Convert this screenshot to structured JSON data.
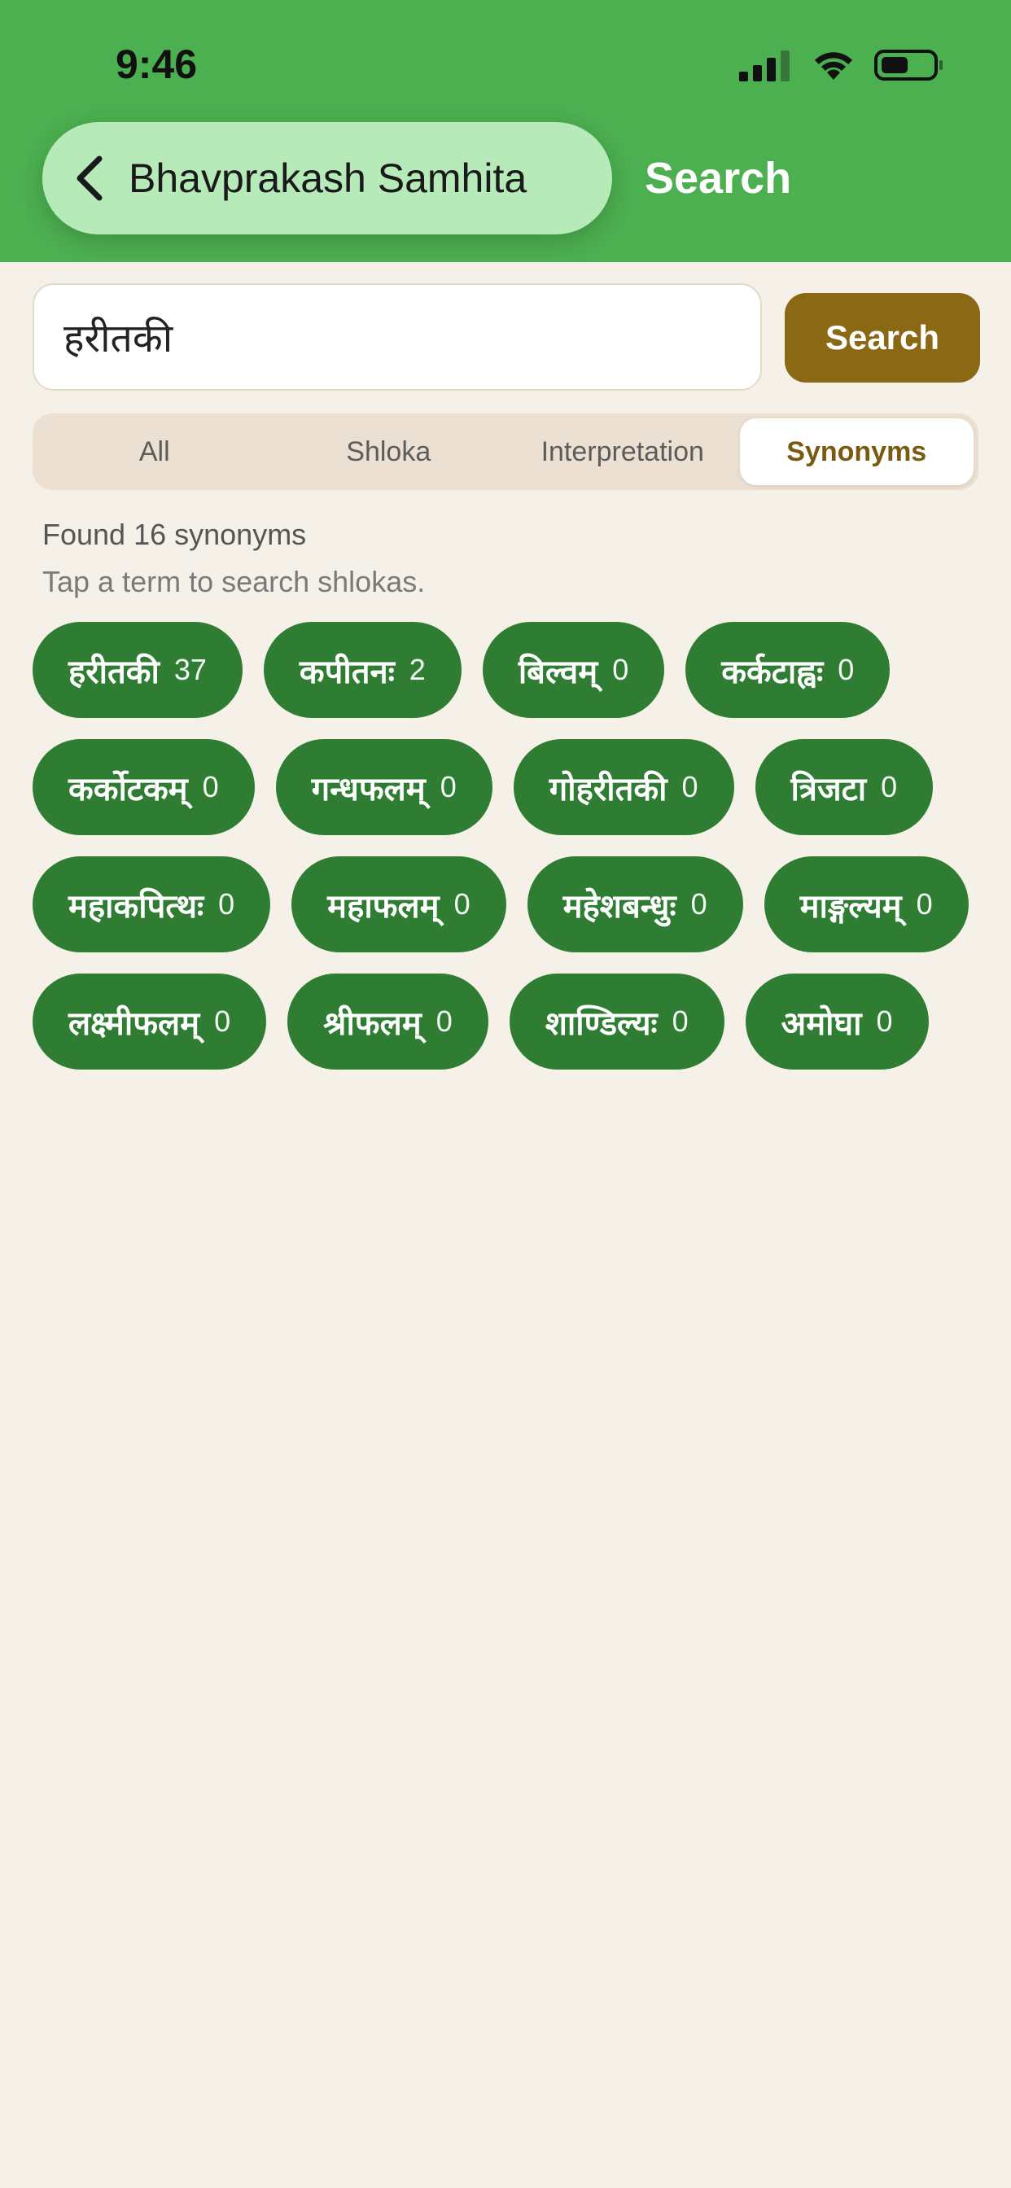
{
  "status_bar": {
    "time": "9:46"
  },
  "header": {
    "back_label": "Bhavprakash Samhita",
    "title": "Search"
  },
  "search": {
    "value": "हरीतकी",
    "button_label": "Search"
  },
  "tabs": [
    {
      "label": "All",
      "active": false
    },
    {
      "label": "Shloka",
      "active": false
    },
    {
      "label": "Interpretation",
      "active": false
    },
    {
      "label": "Synonyms",
      "active": true
    }
  ],
  "results": {
    "found_text": "Found 16 synonyms",
    "hint_text": "Tap a term to search shlokas."
  },
  "synonyms": [
    {
      "term": "हरीतकी",
      "count": "37"
    },
    {
      "term": "कपीतनः",
      "count": "2"
    },
    {
      "term": "बिल्वम्",
      "count": "0"
    },
    {
      "term": "कर्कटाह्वः",
      "count": "0"
    },
    {
      "term": "कर्कोटकम्",
      "count": "0"
    },
    {
      "term": "गन्धफलम्",
      "count": "0"
    },
    {
      "term": "गोहरीतकी",
      "count": "0"
    },
    {
      "term": "त्रिजटा",
      "count": "0"
    },
    {
      "term": "महाकपित्थः",
      "count": "0"
    },
    {
      "term": "महाफलम्",
      "count": "0"
    },
    {
      "term": "महेशबन्धुः",
      "count": "0"
    },
    {
      "term": "माङ्गल्यम्",
      "count": "0"
    },
    {
      "term": "लक्ष्मीफलम्",
      "count": "0"
    },
    {
      "term": "श्रीफलम्",
      "count": "0"
    },
    {
      "term": "शाण्डिल्यः",
      "count": "0"
    },
    {
      "term": "अमोघा",
      "count": "0"
    }
  ],
  "colors": {
    "header_green": "#4CAF50",
    "back_pill": "#B6EAB8",
    "chip_green": "#2E7D32",
    "search_button_brown": "#8B6914",
    "background": "#F5F0E8"
  }
}
